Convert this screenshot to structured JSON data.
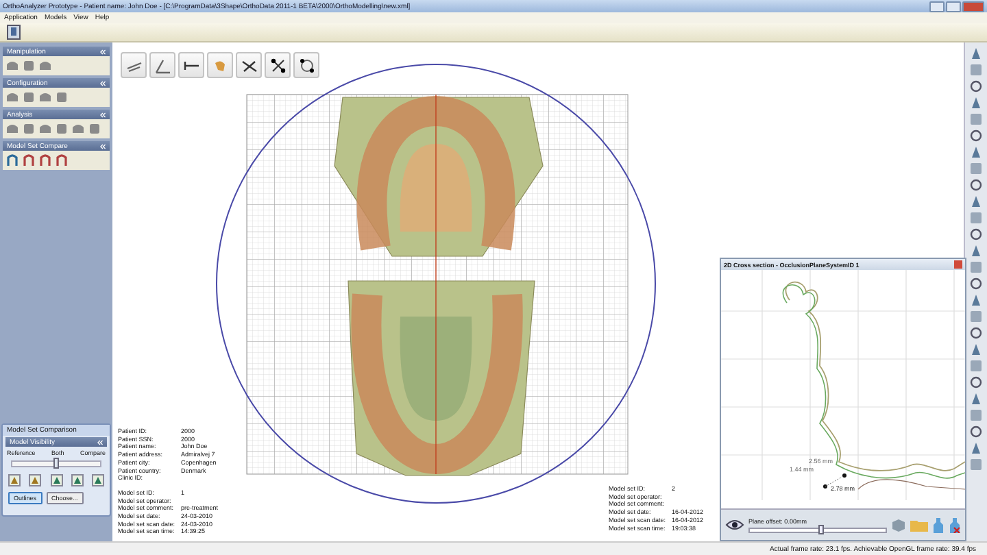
{
  "window": {
    "title": "OrthoAnalyzer Prototype - Patient name: John Doe - [C:\\ProgramData\\3Shape\\OrthoData 2011-1 BETA\\2000\\OrthoModelling\\new.xml]"
  },
  "menu": [
    "Application",
    "Models",
    "View",
    "Help"
  ],
  "panels": [
    {
      "title": "Manipulation",
      "expanded": true
    },
    {
      "title": "Configuration",
      "expanded": true
    },
    {
      "title": "Analysis",
      "expanded": true
    },
    {
      "title": "Model Set Compare",
      "expanded": true
    }
  ],
  "comparison": {
    "title": "Model Set Comparison",
    "section": "Model Visibility",
    "labels": [
      "Reference",
      "Both",
      "Compare"
    ],
    "level": 0.5,
    "buttons": [
      {
        "label": "Outlines",
        "selected": true
      },
      {
        "label": "Choose...",
        "selected": false
      }
    ]
  },
  "patient": [
    {
      "label": "Patient ID:",
      "value": "2000"
    },
    {
      "label": "Patient SSN:",
      "value": "2000"
    },
    {
      "label": "Patient name:",
      "value": "John Doe"
    },
    {
      "label": "Patient address:",
      "value": "Admiralvej 7"
    },
    {
      "label": "Patient city:",
      "value": "Copenhagen"
    },
    {
      "label": "Patient country:",
      "value": "Denmark"
    },
    {
      "label": "Clinic ID:"
    }
  ],
  "model_set_1": [
    {
      "label": "Model set ID:",
      "value": "1"
    },
    {
      "label": "Model set operator:"
    },
    {
      "label": "Model set comment:",
      "value": "pre-treatment"
    },
    {
      "label": "Model set date:",
      "value": "24-03-2010"
    },
    {
      "label": "Model set scan date:",
      "value": "24-03-2010"
    },
    {
      "label": "Model set scan time:",
      "value": "14:39:25"
    }
  ],
  "model_set_2": [
    {
      "label": "Model set ID:",
      "value": "2"
    },
    {
      "label": "Model set operator:"
    },
    {
      "label": "Model set comment:"
    },
    {
      "label": "Model set date:",
      "value": "16-04-2012"
    },
    {
      "label": "Model set scan date:",
      "value": "16-04-2012"
    },
    {
      "label": "Model set scan time:",
      "value": "19:03:38"
    }
  ],
  "cross_section": {
    "title": "2D Cross section - OcclusionPlaneSystemID 1",
    "measurements": [
      "2.56 mm",
      "1.44 mm",
      "2.78 mm"
    ],
    "plane_offset_label": "Plane offset: 0.00mm",
    "level": 0.53
  },
  "status_bar": "Actual frame rate: 23.1 fps. Achievable OpenGL frame rate: 39.4 fps"
}
